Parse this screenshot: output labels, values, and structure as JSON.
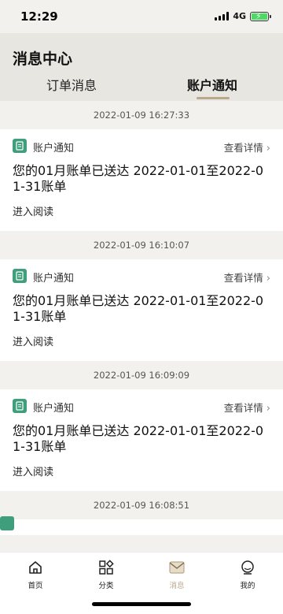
{
  "status_bar": {
    "time": "12:29",
    "network": "4G",
    "signal_icon": "signal-bars-icon",
    "battery_icon": "battery-charging-icon",
    "battery_color": "#4cd964"
  },
  "header": {
    "title": "消息中心",
    "tabs": [
      {
        "label": "订单消息",
        "active": false
      },
      {
        "label": "账户通知",
        "active": true
      }
    ],
    "accent_color": "#b9a889"
  },
  "messages": [
    {
      "timestamp": "2022-01-09 16:27:33",
      "type": "账户通知",
      "detail_label": "查看详情",
      "title": "您的01月账单已送达 2022-01-01至2022-01-31账单",
      "action": "进入阅读"
    },
    {
      "timestamp": "2022-01-09 16:10:07",
      "type": "账户通知",
      "detail_label": "查看详情",
      "title": "您的01月账单已送达 2022-01-01至2022-01-31账单",
      "action": "进入阅读"
    },
    {
      "timestamp": "2022-01-09 16:09:09",
      "type": "账户通知",
      "detail_label": "查看详情",
      "title": "您的01月账单已送达 2022-01-01至2022-01-31账单",
      "action": "进入阅读"
    },
    {
      "timestamp": "2022-01-09 16:08:51"
    }
  ],
  "message_icon": "document-icon",
  "message_icon_color": "#3f9e7b",
  "tabbar": [
    {
      "label": "首页",
      "icon": "home-icon",
      "active": false
    },
    {
      "label": "分类",
      "icon": "category-icon",
      "active": false
    },
    {
      "label": "消息",
      "icon": "message-icon",
      "active": true
    },
    {
      "label": "我的",
      "icon": "profile-icon",
      "active": false
    }
  ]
}
